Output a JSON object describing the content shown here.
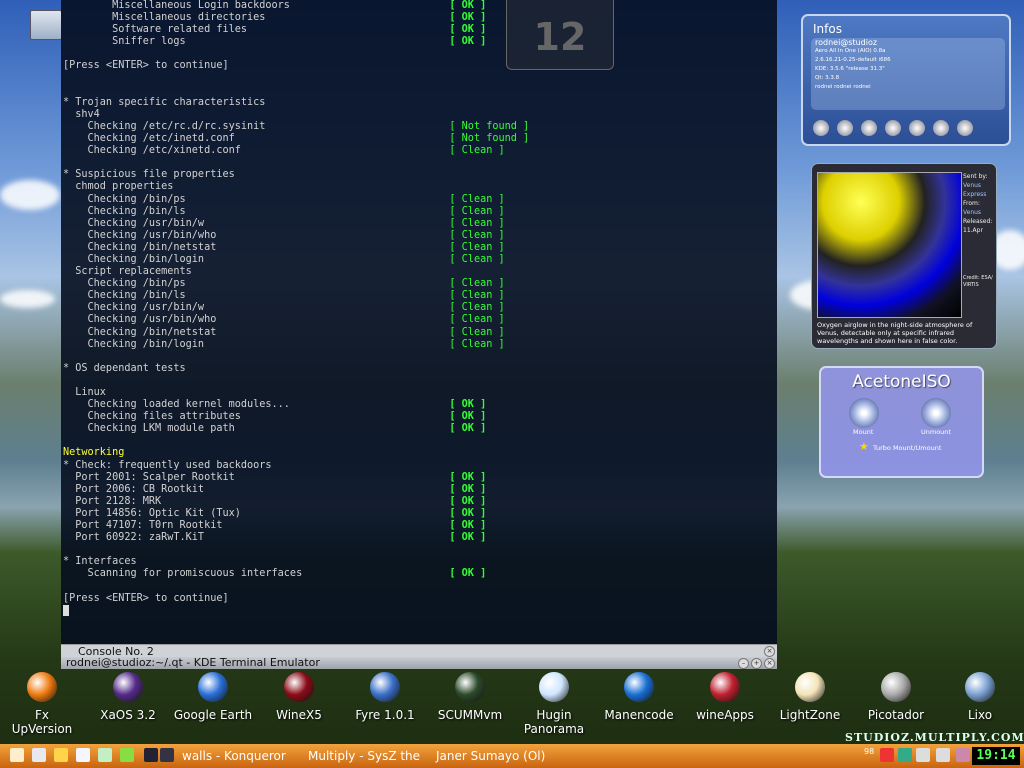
{
  "terminal": {
    "watermark": "12",
    "lines": [
      {
        "t": "        Miscellaneous Login backdoors                          ",
        "s": "[ OK ]",
        "c": "ok"
      },
      {
        "t": "        Miscellaneous directories                              ",
        "s": "[ OK ]",
        "c": "ok"
      },
      {
        "t": "        Software related files                                 ",
        "s": "[ OK ]",
        "c": "ok"
      },
      {
        "t": "        Sniffer logs                                           ",
        "s": "[ OK ]",
        "c": "ok"
      },
      {
        "t": ""
      },
      {
        "t": "[Press <ENTER> to continue]"
      },
      {
        "t": ""
      },
      {
        "t": ""
      },
      {
        "t": "* Trojan specific characteristics"
      },
      {
        "t": "  shv4"
      },
      {
        "t": "    Checking /etc/rc.d/rc.sysinit                              ",
        "s": "[ Not found ]",
        "c": "nf"
      },
      {
        "t": "    Checking /etc/inetd.conf                                   ",
        "s": "[ Not found ]",
        "c": "nf"
      },
      {
        "t": "    Checking /etc/xinetd.conf                                  ",
        "s": "[ Clean ]",
        "c": "cl"
      },
      {
        "t": ""
      },
      {
        "t": "* Suspicious file properties"
      },
      {
        "t": "  chmod properties"
      },
      {
        "t": "    Checking /bin/ps                                           ",
        "s": "[ Clean ]",
        "c": "cl"
      },
      {
        "t": "    Checking /bin/ls                                           ",
        "s": "[ Clean ]",
        "c": "cl"
      },
      {
        "t": "    Checking /usr/bin/w                                        ",
        "s": "[ Clean ]",
        "c": "cl"
      },
      {
        "t": "    Checking /usr/bin/who                                      ",
        "s": "[ Clean ]",
        "c": "cl"
      },
      {
        "t": "    Checking /bin/netstat                                      ",
        "s": "[ Clean ]",
        "c": "cl"
      },
      {
        "t": "    Checking /bin/login                                        ",
        "s": "[ Clean ]",
        "c": "cl"
      },
      {
        "t": "  Script replacements"
      },
      {
        "t": "    Checking /bin/ps                                           ",
        "s": "[ Clean ]",
        "c": "cl"
      },
      {
        "t": "    Checking /bin/ls                                           ",
        "s": "[ Clean ]",
        "c": "cl"
      },
      {
        "t": "    Checking /usr/bin/w                                        ",
        "s": "[ Clean ]",
        "c": "cl"
      },
      {
        "t": "    Checking /usr/bin/who                                      ",
        "s": "[ Clean ]",
        "c": "cl"
      },
      {
        "t": "    Checking /bin/netstat                                      ",
        "s": "[ Clean ]",
        "c": "cl"
      },
      {
        "t": "    Checking /bin/login                                        ",
        "s": "[ Clean ]",
        "c": "cl"
      },
      {
        "t": ""
      },
      {
        "t": "* OS dependant tests"
      },
      {
        "t": ""
      },
      {
        "t": "  Linux"
      },
      {
        "t": "    Checking loaded kernel modules...                          ",
        "s": "[ OK ]",
        "c": "ok"
      },
      {
        "t": "    Checking files attributes                                  ",
        "s": "[ OK ]",
        "c": "ok"
      },
      {
        "t": "    Checking LKM module path                                   ",
        "s": "[ OK ]",
        "c": "ok"
      },
      {
        "t": ""
      },
      {
        "t": "Networking",
        "c": "yl",
        "whole": true
      },
      {
        "t": "* Check: frequently used backdoors"
      },
      {
        "t": "  Port 2001: Scalper Rootkit                                   ",
        "s": "[ OK ]",
        "c": "ok"
      },
      {
        "t": "  Port 2006: CB Rootkit                                        ",
        "s": "[ OK ]",
        "c": "ok"
      },
      {
        "t": "  Port 2128: MRK                                               ",
        "s": "[ OK ]",
        "c": "ok"
      },
      {
        "t": "  Port 14856: Optic Kit (Tux)                                  ",
        "s": "[ OK ]",
        "c": "ok"
      },
      {
        "t": "  Port 47107: T0rn Rootkit                                     ",
        "s": "[ OK ]",
        "c": "ok"
      },
      {
        "t": "  Port 60922: zaRwT.KiT                                        ",
        "s": "[ OK ]",
        "c": "ok"
      },
      {
        "t": ""
      },
      {
        "t": "* Interfaces"
      },
      {
        "t": "    Scanning for promiscuous interfaces                        ",
        "s": "[ OK ]",
        "c": "ok"
      },
      {
        "t": ""
      },
      {
        "t": "[Press <ENTER> to continue]"
      }
    ]
  },
  "console_tab": {
    "label": "Console No. 2"
  },
  "window": {
    "title": "rodnei@studioz:~/.qt - KDE Terminal Emulator"
  },
  "dock": [
    {
      "label": "Fx\nUpVersion",
      "color": "#f07a10",
      "icon": "firefox-icon"
    },
    {
      "label": "XaOS 3.2",
      "color": "#552a8a",
      "icon": "xaos-icon"
    },
    {
      "label": "Google Earth",
      "color": "#2a6fd8",
      "icon": "globe-icon"
    },
    {
      "label": "WineX5",
      "color": "#8a0c18",
      "icon": "wine-icon"
    },
    {
      "label": "Fyre 1.0.1",
      "color": "#3a6fc8",
      "icon": "fyre-icon"
    },
    {
      "label": "SCUMMvm",
      "color": "#2c4a2a",
      "icon": "scummvm-icon"
    },
    {
      "label": "Hugin\nPanorama",
      "color": "#d0e6ff",
      "icon": "hugin-icon"
    },
    {
      "label": "Manencode",
      "color": "#1a6fd6",
      "icon": "play-icon"
    },
    {
      "label": "wineApps",
      "color": "#c02030",
      "icon": "joystick-icon"
    },
    {
      "label": "LightZone",
      "color": "#f3e4b8",
      "icon": "egg-icon"
    },
    {
      "label": "Picotador",
      "color": "#aaaaaa",
      "icon": "scissors-icon"
    },
    {
      "label": "Lixo",
      "color": "#7aa0d0",
      "icon": "trash-icon"
    }
  ],
  "infos": {
    "title": "Infos",
    "user": "rodnei@studioz",
    "distro": "Aero All In One (AIO) 0.8a",
    "kernel": "2.6.16.21-0.25-default i686",
    "kde": "KDE: 3.5.6 \"release 31.3\"",
    "qt": "Qt: 3.3.8",
    "users": "rodnei rodnei rodnei"
  },
  "venus": {
    "sent_by_label": "Sent by:",
    "sent_by": "Venus Express",
    "from_label": "From:",
    "from": "Venus",
    "released_label": "Released:",
    "released": "11.Apr",
    "credit": "Credit: ESA/ VIRTIS",
    "caption": "Oxygen airglow in the night-side atmosphere of Venus, detectable only at specific infrared wavelengths and shown here in false color."
  },
  "acetoneiso": {
    "title": "AcetoneISO",
    "mount": "Mount",
    "unmount": "Unmount",
    "turbo": "Turbo Mount/Umount"
  },
  "taskbar": {
    "tasks": [
      "walls - Konqueror",
      "Multiply - SysZ the",
      "Janer Sumayo (Ol)"
    ],
    "clock": "19:14",
    "volume": "98"
  },
  "watermark_site": "STUDIOZ.MULTIPLY.COM"
}
